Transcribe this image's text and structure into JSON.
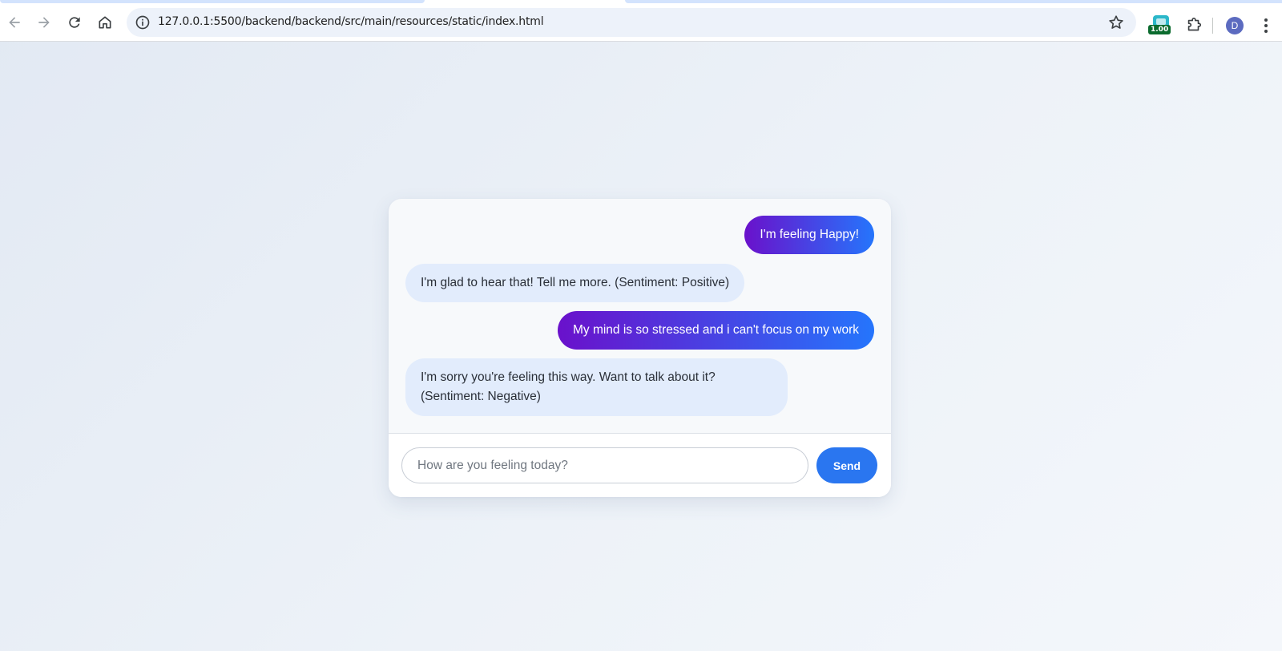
{
  "browser": {
    "url": "127.0.0.1:5500/backend/backend/src/main/resources/static/index.html",
    "extension_badge": "1.00",
    "profile_initial": "D",
    "icons": {
      "back": "arrow-left-icon",
      "forward": "arrow-right-icon",
      "reload": "reload-icon",
      "home": "home-icon",
      "site_info": "info-icon",
      "bookmark": "star-icon",
      "extensions": "puzzle-icon",
      "menu": "kebab-menu-icon"
    }
  },
  "chat": {
    "messages": [
      {
        "role": "user",
        "text": "I'm feeling Happy!"
      },
      {
        "role": "bot",
        "text": "I'm glad to hear that! Tell me more. (Sentiment: Positive)"
      },
      {
        "role": "user",
        "text": "My mind is so stressed and i can't focus on my work"
      },
      {
        "role": "bot",
        "text": "I'm sorry you're feeling this way. Want to talk about it? (Sentiment: Negative)"
      }
    ],
    "input": {
      "value": "",
      "placeholder": "How are you feeling today?"
    },
    "send_label": "Send"
  },
  "colors": {
    "user_bubble_start": "#6a11cb",
    "user_bubble_end": "#2575fc",
    "bot_bubble": "#e2ecfc",
    "send_button": "#2a76f0"
  }
}
